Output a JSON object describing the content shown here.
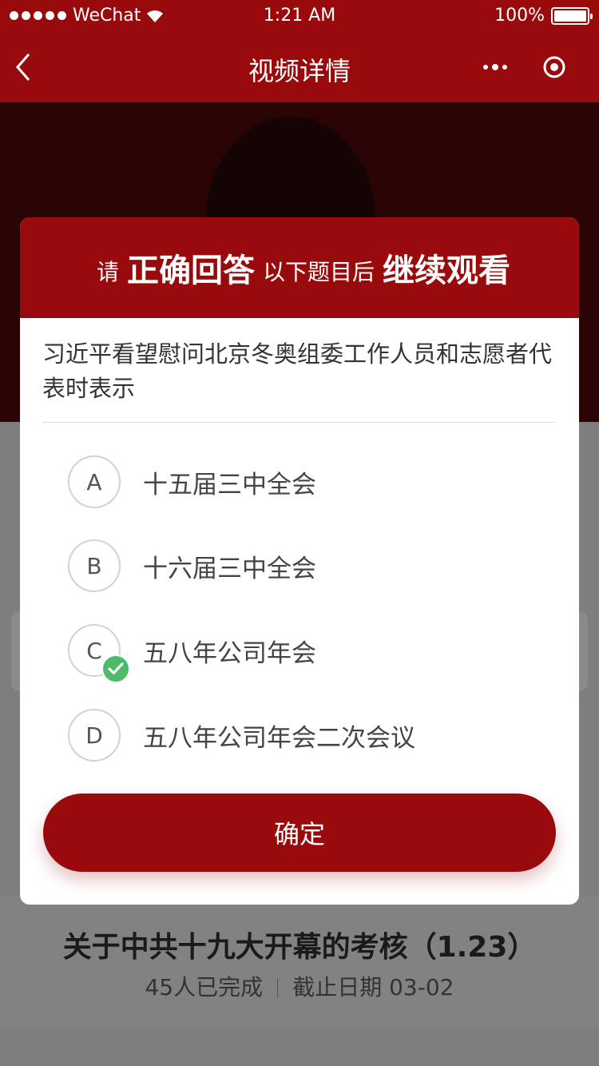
{
  "status_bar": {
    "carrier": "WeChat",
    "time": "1:21 AM",
    "battery": "100%",
    "battery_level": 1.0
  },
  "nav": {
    "title": "视频详情",
    "back_icon": "chevron-left-icon",
    "more_icon": "more-dots-icon",
    "target_icon": "target-icon"
  },
  "modal": {
    "header_parts": [
      "请",
      "正确回答",
      "以下题目后",
      "继续观看"
    ],
    "question": "习近平看望慰问北京冬奥组委工作人员和志愿者代表时表示",
    "options": [
      {
        "letter": "A",
        "text": "十五届三中全会",
        "selected": false
      },
      {
        "letter": "B",
        "text": "十六届三中全会",
        "selected": false
      },
      {
        "letter": "C",
        "text": "五八年公司年会",
        "selected": true
      },
      {
        "letter": "D",
        "text": "五八年公司年会二次会议",
        "selected": false
      }
    ],
    "confirm_label": "确定"
  },
  "exam": {
    "title": "关于中共十九大开幕的考核（1.23）",
    "completed": "45人已完成",
    "deadline": "截止日期  03-02"
  },
  "colors": {
    "brand_red": "#980a0b",
    "check_green": "#4dbb6a"
  }
}
